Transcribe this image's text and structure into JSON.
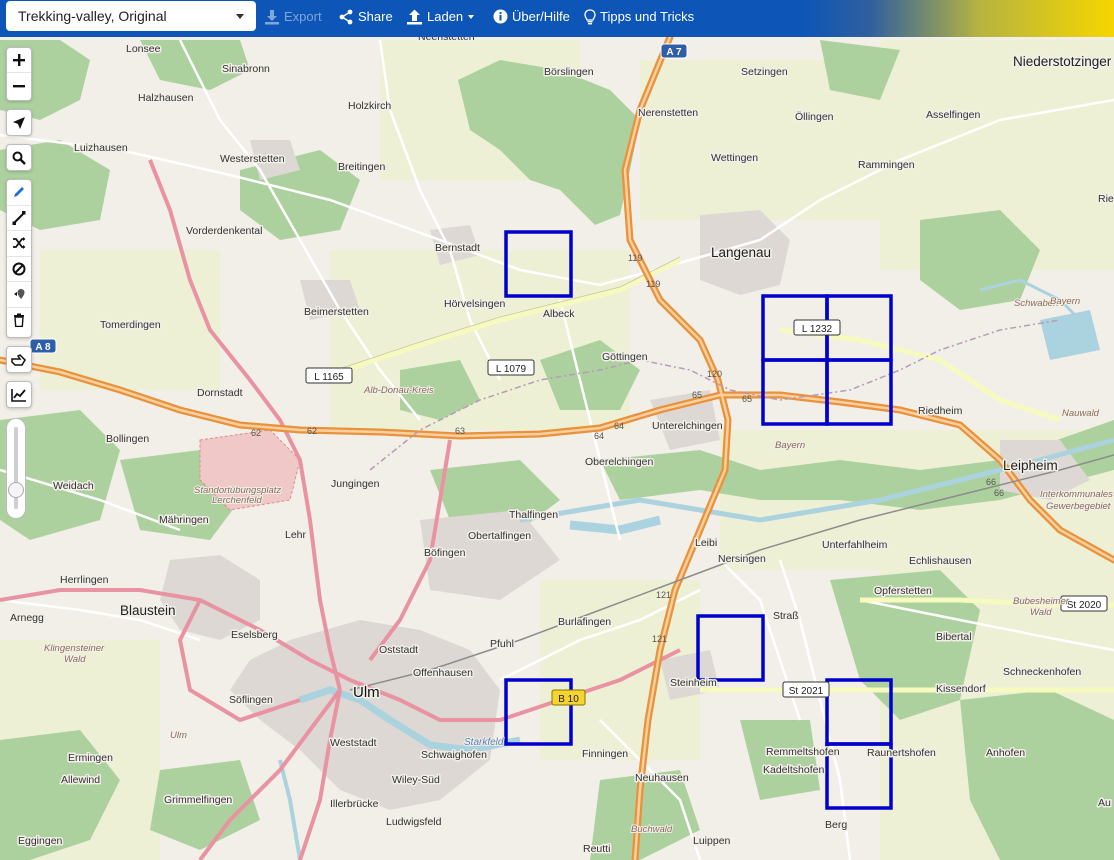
{
  "topbar": {
    "profile": "Trekking-valley, Original",
    "export_label": "Export",
    "share_label": "Share",
    "load_label": "Laden",
    "about_label": "Über/Hilfe",
    "tips_label": "Tipps und Tricks"
  },
  "colors": {
    "topbar_blue": "#0d56b8",
    "topbar_yellow": "#f6d600",
    "tile_outline": "#0000cc",
    "motorway": "#e8923c",
    "primary_road": "#e46f8e",
    "forest": "#add19e",
    "water": "#aad3df"
  },
  "zoom_slider": {
    "level": 0.78
  },
  "map": {
    "places": {
      "lonsee": "Lonsee",
      "sinabronn": "Sinabronn",
      "halzhausen": "Halzhausen",
      "holzkirch": "Holzkirch",
      "neenstetten": "Neenstetten",
      "boerslingen": "Börslingen",
      "setzingen": "Setzingen",
      "niederstotzingen": "Niederstotzinger",
      "luizhausen": "Luizhausen",
      "westerstetten": "Westerstetten",
      "breitingen": "Breitingen",
      "nerenstetten": "Nerenstetten",
      "oellingen": "Öllingen",
      "asselfingen": "Asselfingen",
      "wettingen": "Wettingen",
      "rammingen": "Rammingen",
      "vorderdenkental": "Vorderdenkental",
      "bernstadt": "Bernstadt",
      "langenau": "Langenau",
      "rie": "Rie",
      "beimerstetten": "Beimerstetten",
      "hoervelsingen": "Hörvelsingen",
      "albeck": "Albeck",
      "tomerdingen": "Tomerdingen",
      "goettingen": "Göttingen",
      "alb_donau_kreis": "Alb-Donau-Kreis",
      "riedheim": "Riedheim",
      "schwaben": "Schwaben",
      "bayern": "Bayern",
      "bayern2": "Bayern",
      "nauwald": "Nauwald",
      "dornstadt": "Dornstadt",
      "unterelchingen": "Unterelchingen",
      "bollingen": "Bollingen",
      "oberelchingen": "Oberelchingen",
      "leipheim": "Leipheim",
      "standortuebungsplatz": "Standortübungsplatz",
      "lerchenfeld": "Lerchenfeld",
      "weidach": "Weidach",
      "jungingen": "Jungingen",
      "interkommunales": "Interkommunales",
      "gewerbegebiet": "Gewerbegebiet",
      "thalfingen": "Thalfingen",
      "maehringen": "Mähringen",
      "lehr": "Lehr",
      "obertalfingen": "Obertalfingen",
      "leibi": "Leibi",
      "unterfahlheim": "Unterfahlheim",
      "boefingen": "Böfingen",
      "nersingen": "Nersingen",
      "echlishausen": "Echlishausen",
      "herrlingen": "Herrlingen",
      "opferstetten": "Opferstetten",
      "blaustein": "Blaustein",
      "bubesheimer_wald": "Bubesheimer",
      "bubesheimer_wald2": "Wald",
      "arnegg": "Arnegg",
      "strass": "Straß",
      "burlafingen": "Burlafingen",
      "pfuhl": "Pfuhl",
      "eselsberg": "Eselsberg",
      "klingensteiner": "Klingensteiner",
      "klingensteiner2": "Wald",
      "oststadt": "Oststadt",
      "bibertal": "Bibertal",
      "offenhausen": "Offenhausen",
      "schneckenhofen": "Schneckenhofen",
      "ulm": "Ulm",
      "steinheim": "Steinheim",
      "kissendorf": "Kissendorf",
      "soeflingen": "Söflingen",
      "weststadt": "Weststadt",
      "starkfeld": "Starkfeld",
      "ulm_forest": "Ulm",
      "remmeltshofen": "Remmeltshofen",
      "raunertshofen": "Raunertshofen",
      "anhofen": "Anhofen",
      "ermingen": "Ermingen",
      "schwaighofen": "Schwaighofen",
      "finningen": "Finningen",
      "kadeltshofen": "Kadeltshofen",
      "allewind": "Allewind",
      "wiley_sued": "Wiley-Süd",
      "neuhausen": "Neuhausen",
      "grimmelfingen": "Grimmelfingen",
      "illerbruecke": "Illerbrücke",
      "au": "Au",
      "ludwigsfeld": "Ludwigsfeld",
      "buchwald": "Buchwald",
      "eggingen": "Eggingen",
      "reutti": "Reutti",
      "luippen": "Luippen",
      "berg": "Berg"
    },
    "road_labels": {
      "a7": "A 7",
      "a8": "A 8",
      "l1165": "L 1165",
      "l1079": "L 1079",
      "l1232": "L 1232",
      "st2020": "St 2020",
      "st2021": "St 2021",
      "b10": "B 10",
      "r119a": "119",
      "r119b": "119",
      "r120": "120",
      "r121a": "121",
      "r121b": "121",
      "r62a": "62",
      "r62b": "62",
      "r63": "63",
      "r64a": "64",
      "r64b": "64",
      "r65a": "65",
      "r65b": "65",
      "r66a": "66",
      "r66b": "66"
    }
  }
}
